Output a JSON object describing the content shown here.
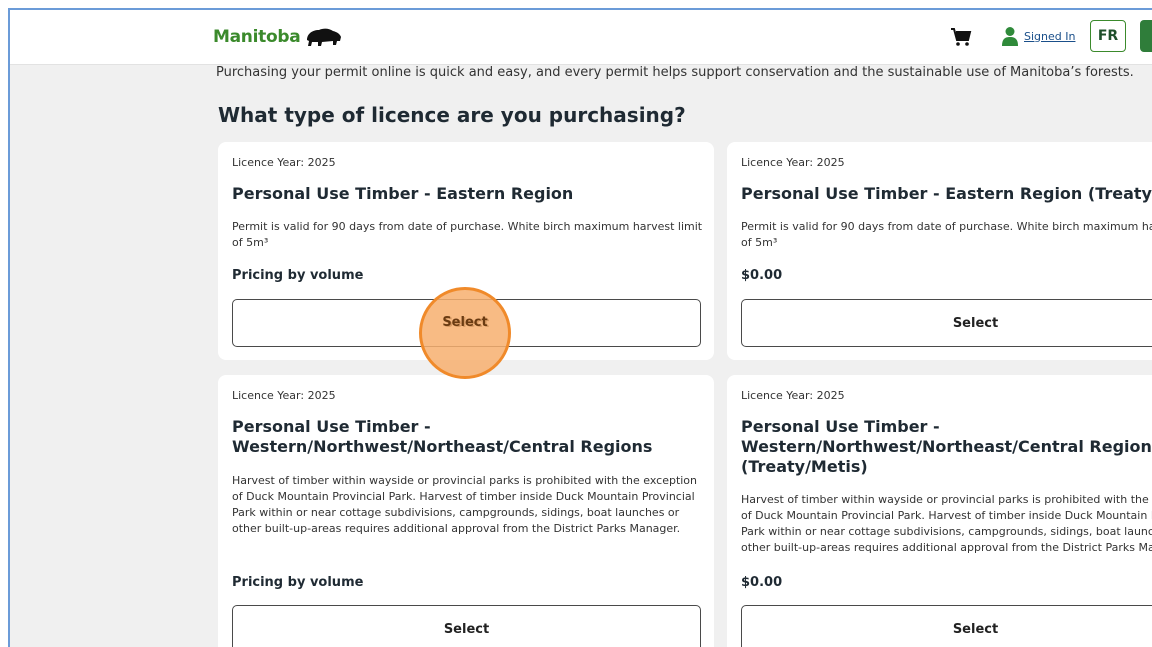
{
  "header": {
    "brand": "Manitoba",
    "signed_in": "Signed In",
    "lang_button": "FR",
    "cart_icon": "cart-icon",
    "user_icon": "user-icon",
    "brand_color": "#3b8a2c"
  },
  "intro_text": "Purchasing your permit online is quick and easy, and every permit helps support conservation and the sustainable use of Manitoba’s forests.",
  "heading": "What type of licence are you purchasing?",
  "cards": [
    {
      "year": "Licence Year: 2025",
      "title_line1": "Personal Use Timber - Eastern Region",
      "desc_line1": "Permit is valid for 90 days from date of purchase. White birch maximum harvest limit",
      "desc_line2": "of 5m³",
      "price": "Pricing by volume",
      "button": "Select"
    },
    {
      "year": "Licence Year: 2025",
      "title_line1": "Personal Use Timber - Eastern Region (Treaty/Me",
      "desc_line1": "Permit is valid for 90 days from date of purchase. White birch maximum ha",
      "desc_line2": "of 5m³",
      "price": "$0.00",
      "button": "Select"
    },
    {
      "year": "Licence Year: 2025",
      "title_line1": "Personal Use Timber -",
      "title_line2": "Western/Northwest/Northeast/Central Regions",
      "desc_line1": "Harvest of timber within wayside or provincial parks is prohibited with the exception",
      "desc_line2": "of Duck Mountain Provincial Park. Harvest of timber inside Duck Mountain Provincial",
      "desc_line3": "Park within or near cottage subdivisions, campgrounds, sidings, boat launches or",
      "desc_line4": "other built-up-areas requires additional approval from the District Parks Manager.",
      "price": "Pricing by volume",
      "button": "Select"
    },
    {
      "year": "Licence Year: 2025",
      "title_line1": "Personal Use Timber -",
      "title_line2": "Western/Northwest/Northeast/Central Regions",
      "title_line3": "(Treaty/Metis)",
      "desc_line1": "Harvest of timber within wayside or provincial parks is prohibited with the e",
      "desc_line2": "of Duck Mountain Provincial Park. Harvest of timber inside Duck Mountain I",
      "desc_line3": "Park within or near cottage subdivisions, campgrounds, sidings, boat launc",
      "desc_line4": "other built-up-areas requires additional approval from the District Parks Ma",
      "price": "$0.00",
      "button": "Select"
    }
  ],
  "click_indicator_color": "#f08a2a"
}
